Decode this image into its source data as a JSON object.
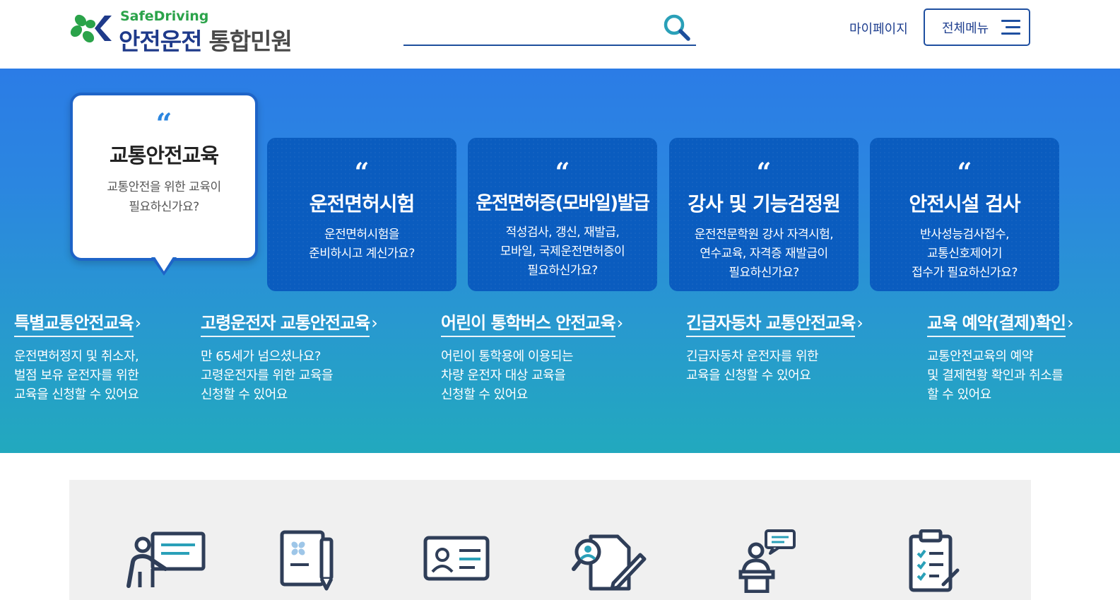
{
  "header": {
    "logo_sub": "SafeDriving",
    "logo_main": "안전운전",
    "logo_main_gray": "통합민원",
    "search_placeholder": "",
    "mypage_label": "마이페이지",
    "allmenu_label": "전체메뉴"
  },
  "colors": {
    "brand_navy": "#1e3a8a",
    "brand_green": "#2ba34a",
    "hero_top": "#2b7ce6",
    "hero_bottom": "#22a9be",
    "card_bg": "#0a5cbf",
    "accent_blue": "#1f4fa0"
  },
  "main_cards": [
    {
      "title": "교통안전교육",
      "desc": "교통안전을 위한 교육이\n필요하신가요?",
      "active": true
    },
    {
      "title": "운전면허시험",
      "desc": "운전면허시험을\n준비하시고 계신가요?"
    },
    {
      "title": "운전면허증(모바일)발급",
      "desc": "적성검사, 갱신, 재발급,\n모바일, 국제운전면허증이\n필요하신가요?"
    },
    {
      "title": "강사 및 기능검정원",
      "desc": "운전전문학원 강사 자격시험,\n연수교육, 자격증 재발급이\n필요하신가요?"
    },
    {
      "title": "안전시설 검사",
      "desc": "반사성능검사접수,\n교통신호제어기\n접수가 필요하신가요?"
    }
  ],
  "quote_mark": "“",
  "sub_links": [
    {
      "title": "특별교통안전교육",
      "desc": "운전면허정지 및 취소자,\n벌점 보유 운전자를 위한\n교육을 신청할 수 있어요"
    },
    {
      "title": "고령운전자 교통안전교육",
      "desc": "만 65세가 넘으셨나요?\n고령운전자를 위한 교육을\n신청할 수 있어요"
    },
    {
      "title": "어린이 통학버스 안전교육",
      "desc": "어린이 통학용에 이용되는\n차량 운전자 대상 교육을\n신청할 수 있어요"
    },
    {
      "title": "긴급자동차 교통안전교육",
      "desc": "긴급자동차 운전자를 위한\n교육을 신청할 수 있어요"
    },
    {
      "title": "교육 예약(결제)확인",
      "desc": "교통안전교육의 예약\n및 결제현황 확인과 취소를\n할 수 있어요"
    }
  ],
  "arrow_glyph": "›",
  "quick_icons": [
    "lecture-icon",
    "document-pen-icon",
    "id-card-icon",
    "search-document-icon",
    "speaker-podium-icon",
    "checklist-icon"
  ]
}
